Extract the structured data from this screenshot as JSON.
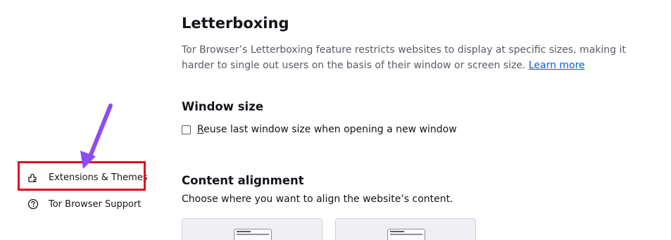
{
  "sidebar": {
    "items": [
      {
        "label": "Extensions & Themes",
        "icon": "puzzle-icon"
      },
      {
        "label": "Tor Browser Support",
        "icon": "help-circle-icon"
      }
    ]
  },
  "letterboxing": {
    "title": "Letterboxing",
    "description": "Tor Browser’s Letterboxing feature restricts websites to display at specific sizes, making it harder to single out users on the basis of their window or screen size.",
    "learn_more": "Learn more"
  },
  "window_size": {
    "title": "Window size",
    "checkbox_first_letter": "R",
    "checkbox_rest": "euse last window size when opening a new window",
    "checked": false
  },
  "content_alignment": {
    "title": "Content alignment",
    "description": "Choose where you want to align the website’s content.",
    "options": [
      "align-top",
      "align-middle"
    ]
  },
  "annotation": {
    "highlight_color": "#e00b22",
    "arrow_color": "#8c4cf5"
  },
  "colors": {
    "link": "#0061e0",
    "muted_text": "#5b5b66"
  }
}
